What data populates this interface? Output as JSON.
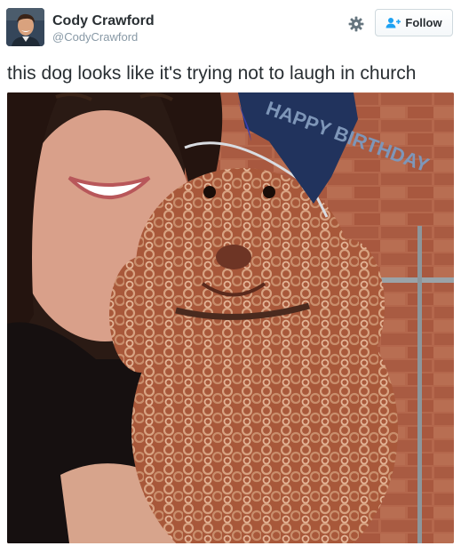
{
  "tweet": {
    "author": {
      "display_name": "Cody Crawford",
      "handle": "@CodyCrawford",
      "avatar_icon": "user-avatar"
    },
    "actions": {
      "settings_icon": "gear-icon",
      "follow_label": "Follow",
      "follow_icon": "add-user-icon"
    },
    "text": "this dog looks like it's trying not to laugh in church",
    "media": {
      "type": "photo",
      "hat_text": "HAPPY BIRTHDAY"
    }
  },
  "colors": {
    "text_primary": "#292f33",
    "text_secondary": "#8899a6",
    "accent_blue": "#1da1f2",
    "button_border": "#cfd9de"
  }
}
